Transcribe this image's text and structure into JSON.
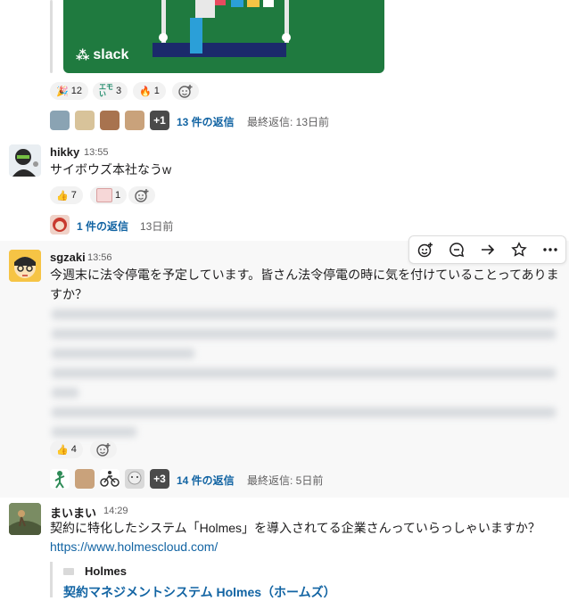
{
  "top_post": {
    "unfurl_logo": "slack",
    "reactions": [
      {
        "icon": "party-popper",
        "count": "12"
      },
      {
        "icon": "emo-text",
        "emoji_text": "エモい",
        "count": "3"
      },
      {
        "icon": "flame",
        "count": "1"
      }
    ],
    "thread": {
      "more_avatars": "+1",
      "replies": "13 件の返信",
      "last_reply": "最終返信: 13日前"
    }
  },
  "msg_hikky": {
    "name": "hikky",
    "time": "13:55",
    "text": "サイボウズ本社なうw",
    "reactions": [
      {
        "icon": "thumbs-up",
        "count": "7"
      },
      {
        "icon": "stamp",
        "count": "1"
      }
    ],
    "thread": {
      "replies": "1 件の返信",
      "last_reply": "13日前"
    }
  },
  "msg_sgzaki": {
    "name": "sgzaki",
    "time": "13:56",
    "text": "今週末に法令停電を予定しています。皆さん法令停電の時に気を付けていることってありますか？",
    "reactions": [
      {
        "icon": "thumbs-up",
        "count": "4"
      }
    ],
    "thread": {
      "more_avatars": "+3",
      "replies": "14 件の返信",
      "last_reply": "最終返信: 5日前"
    }
  },
  "msg_maimai": {
    "name": "まいまい",
    "time": "14:29",
    "text": "契約に特化したシステム「Holmes」を導入されてる企業さんっていらっしゃいますか？",
    "link": "https://www.holmescloud.com/",
    "ref_title": "Holmes",
    "ref_link": "契約マネジメントシステム Holmes（ホームズ）"
  },
  "colors": {
    "link": "#1264a3",
    "hover_bg": "#f8f8f8",
    "slack_green": "#1f7a3f"
  }
}
